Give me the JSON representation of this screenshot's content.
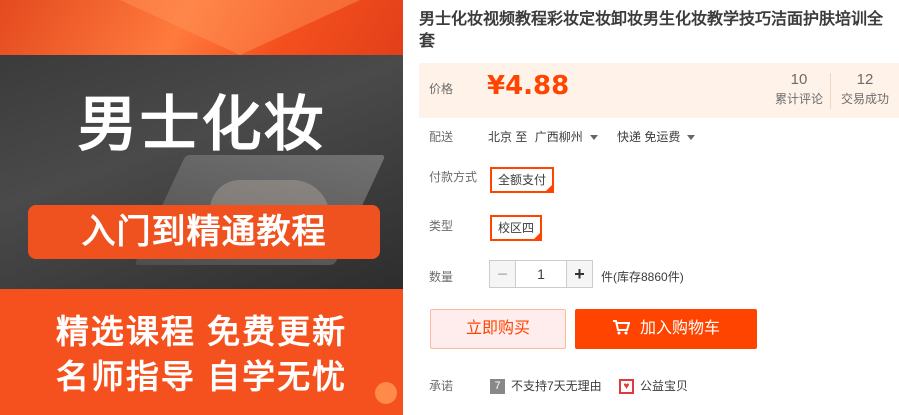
{
  "product_image": {
    "headline": "男士化妆",
    "pill_text": "入门到精通教程",
    "line1": "精选课程 免费更新",
    "line2": "名师指导 自学无忧"
  },
  "product": {
    "title": "男士化妆视频教程彩妆定妆卸妆男生化妆教学技巧洁面护肤培训全套"
  },
  "price": {
    "label": "价格",
    "value": "¥4.88",
    "reviews_count": "10",
    "reviews_label": "累计评论",
    "sales_count": "12",
    "sales_label": "交易成功"
  },
  "shipping": {
    "label": "配送",
    "from": "北京 至",
    "to": "广西柳州",
    "method": "快递 免运费"
  },
  "payment": {
    "label": "付款方式",
    "option": "全额支付"
  },
  "type": {
    "label": "类型",
    "option": "校区四"
  },
  "quantity": {
    "label": "数量",
    "minus": "−",
    "value": "1",
    "plus": "+",
    "stock": "件(库存8860件)"
  },
  "actions": {
    "buy_now": "立即购买",
    "add_to_cart": "加入购物车"
  },
  "promise": {
    "label": "承诺",
    "item1": "不支持7天无理由",
    "item2": "公益宝贝"
  },
  "colors": {
    "accent": "#ff4400",
    "price_bg": "#fff2e8"
  }
}
